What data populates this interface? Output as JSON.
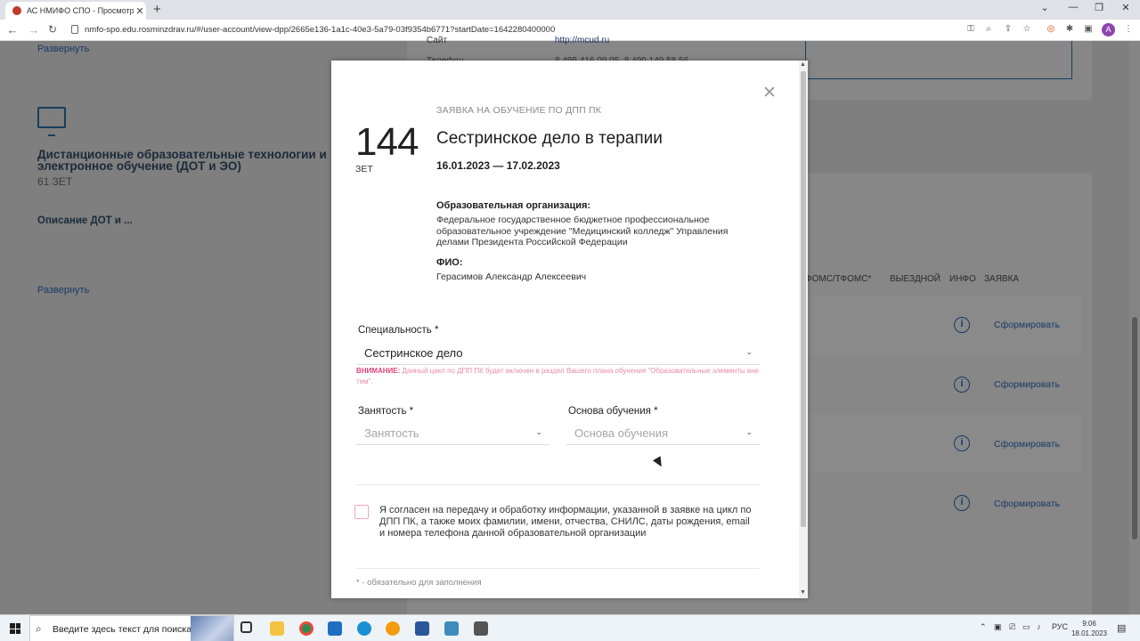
{
  "browser": {
    "tab_title": "АС НМИФО СПО - Просмотр Д",
    "tab_close": "✕",
    "new_tab": "+",
    "url": "nmfo-spo.edu.rosminzdrav.ru/#/user-account/view-dpp/2665e136-1a1c-40e3-5a79-03f9354b6771?startDate=1642280400000",
    "window_minimize": "—",
    "window_restore": "❐",
    "window_close": "✕",
    "profile_initial": "A"
  },
  "background_page": {
    "expand_link_top": "Развернуть",
    "section_title": "Дистанционные образовательные технологии и электронное обучение (ДОТ и ЭО)",
    "section_zet": "61 ЗЕТ",
    "description": "Описание ДОТ и ...",
    "expand_link_bottom": "Развернуть",
    "top_partial_1": "Сайт",
    "top_partial_2": "http://mcud.ru",
    "top_partial_3": "Телефон",
    "top_partial_4": "8 495 416 09 05, 8 499 149 58 56",
    "table_headers": [
      "ФОМС/ТФОМС*",
      "ВЫЕЗДНОЙ",
      "ИНФО",
      "ЗАЯВКА"
    ],
    "rows": [
      {
        "action": "Сформировать"
      },
      {
        "action": "Сформировать"
      },
      {
        "action": "Сформировать"
      },
      {
        "action": "Сформировать"
      }
    ]
  },
  "modal": {
    "kicker": "ЗАЯВКА НА ОБУЧЕНИЕ ПО ДПП ПК",
    "zet_value": "144",
    "zet_label": "ЗЕТ",
    "title": "Сестринское дело в терапии",
    "dates": "16.01.2023 — 17.02.2023",
    "org_label": "Образовательная организация:",
    "org_value": "Федеральное государственное бюджетное профессиональное образовательное учреждение \"Медицинский колледж\" Управления делами Президента Российской Федерации",
    "fio_label": "ФИО:",
    "fio_value": "Герасимов Александр Алексеевич",
    "specialty_label": "Специальность *",
    "specialty_value": "Сестринское дело",
    "warning_prefix": "ВНИМАНИЕ:",
    "warning_text": " Данный цикл по ДПП ПК будет включен в раздел Вашего плана обучения \"Образовательные элементы вне тем\".",
    "employment_label": "Занятость *",
    "employment_placeholder": "Занятость",
    "basis_label": "Основа обучения *",
    "basis_placeholder": "Основа обучения",
    "consent_text": "Я согласен на передачу и обработку информации, указанной в заявке на цикл по ДПП ПК, а также моих фамилии, имени, отчества, СНИЛС, даты рождения, email и номера телефона данной образовательной организации",
    "required_note": "* - обязательно для заполнения"
  },
  "taskbar": {
    "search_placeholder": "Введите здесь текст для поиска",
    "language": "РУС",
    "time": "9:06",
    "date": "18.01.2023"
  },
  "colors": {
    "accent_link": "#1a3a66",
    "warning_pink": "#e0447a",
    "overlay": "#7f7f7f"
  }
}
